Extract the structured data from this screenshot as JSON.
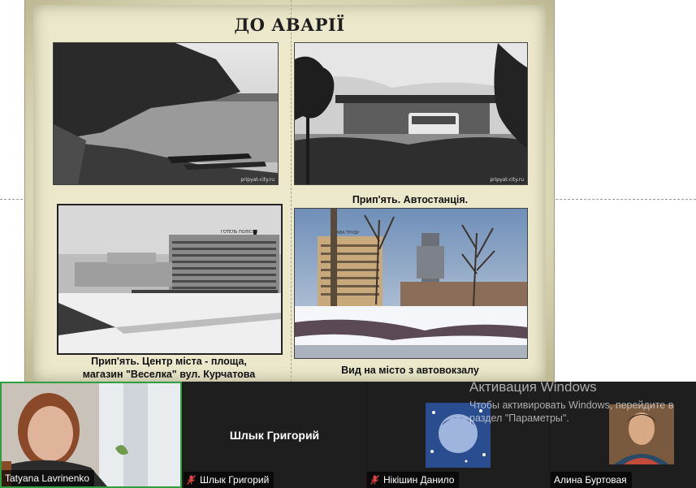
{
  "slide": {
    "title": "ДО АВАРІЇ",
    "captions": {
      "bus_station": "Прип'ять. Автостанція.",
      "center_line1": "Прип'ять. Центр міста - площа,",
      "center_line2": "магазин \"Веселка\" вул. Курчатова",
      "view": "Вид на місто з автовокзалу"
    },
    "watermarks": [
      "pripyat-city.ru",
      "pripyat-city.ru"
    ],
    "sign_texts": [
      "ГОТЕЛЬ ПОЛІССЯ",
      "СЛАВА ТРУДУ"
    ]
  },
  "participants": [
    {
      "name": "Tatyana Lavrinenko",
      "muted": false,
      "video": true
    },
    {
      "name": "Шлык Григорий",
      "muted": true,
      "video": false,
      "display_name": "Шлык Григорий"
    },
    {
      "name": "Нікішин Данило",
      "muted": true,
      "video": false
    },
    {
      "name": "Алина Буртовая",
      "muted": false,
      "video": false
    }
  ],
  "activation": {
    "title": "Активация Windows",
    "subtitle": "Чтобы активировать Windows, перейдите в раздел \"Параметры\"."
  },
  "colors": {
    "active_speaker_border": "#2f9e3e",
    "muted_icon": "#e04444",
    "strip_bg": "#1a1a1a"
  }
}
